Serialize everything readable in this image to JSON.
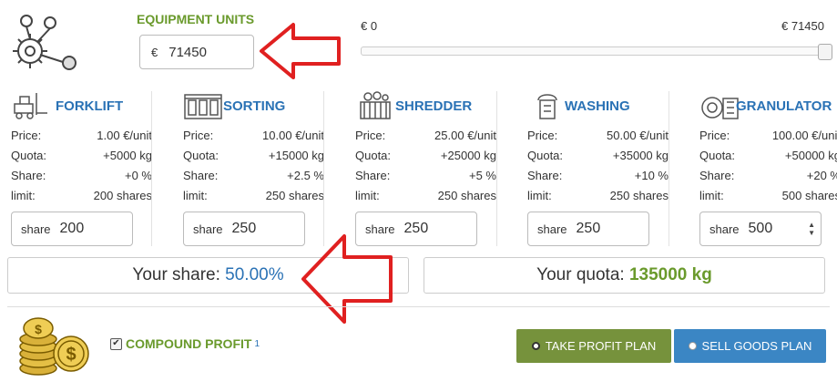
{
  "equipment": {
    "title": "EQUIPMENT UNITS",
    "currency": "€",
    "value": "71450",
    "slider_min_label": "€ 0",
    "slider_max_label": "€ 71450",
    "slider_fraction": 1.0
  },
  "labels": {
    "price": "Price:",
    "quota": "Quota:",
    "share": "Share:",
    "limit": "limit:",
    "share_input": "share"
  },
  "units": [
    {
      "name": "FORKLIFT",
      "price": "1.00 €/unit",
      "quota": "+5000 kg",
      "share": "+0 %",
      "limit": "200 shares",
      "share_value": "200",
      "icon": "forklift-icon"
    },
    {
      "name": "SORTING",
      "price": "10.00 €/unit",
      "quota": "+15000 kg",
      "share": "+2.5 %",
      "limit": "250 shares",
      "share_value": "250",
      "icon": "sorting-machine-icon"
    },
    {
      "name": "SHREDDER",
      "price": "25.00 €/unit",
      "quota": "+25000 kg",
      "share": "+5 %",
      "limit": "250 shares",
      "share_value": "250",
      "icon": "shredder-icon"
    },
    {
      "name": "WASHING",
      "price": "50.00 €/unit",
      "quota": "+35000 kg",
      "share": "+10 %",
      "limit": "250 shares",
      "share_value": "250",
      "icon": "washing-machine-icon"
    },
    {
      "name": "GRANULATOR",
      "price": "100.00 €/unit",
      "quota": "+50000 kg",
      "share": "+20 %",
      "limit": "500 shares",
      "share_value": "500",
      "icon": "granulator-icon"
    }
  ],
  "summary": {
    "share_label": "Your share:",
    "share_value": "50.00%",
    "quota_label": "Your quota:",
    "quota_value": "135000 kg"
  },
  "footer": {
    "compound_label": "COMPOUND PROFIT",
    "compound_sup": "1",
    "compound_checked": true,
    "take_profit_label": "TAKE PROFIT PLAN",
    "sell_goods_label": "SELL GOODS PLAN"
  },
  "colors": {
    "green": "#6a9a2c",
    "blue": "#2a72b5",
    "take_profit_bg": "#76923c",
    "sell_goods_bg": "#3b86c4",
    "arrow_red": "#e02020"
  }
}
